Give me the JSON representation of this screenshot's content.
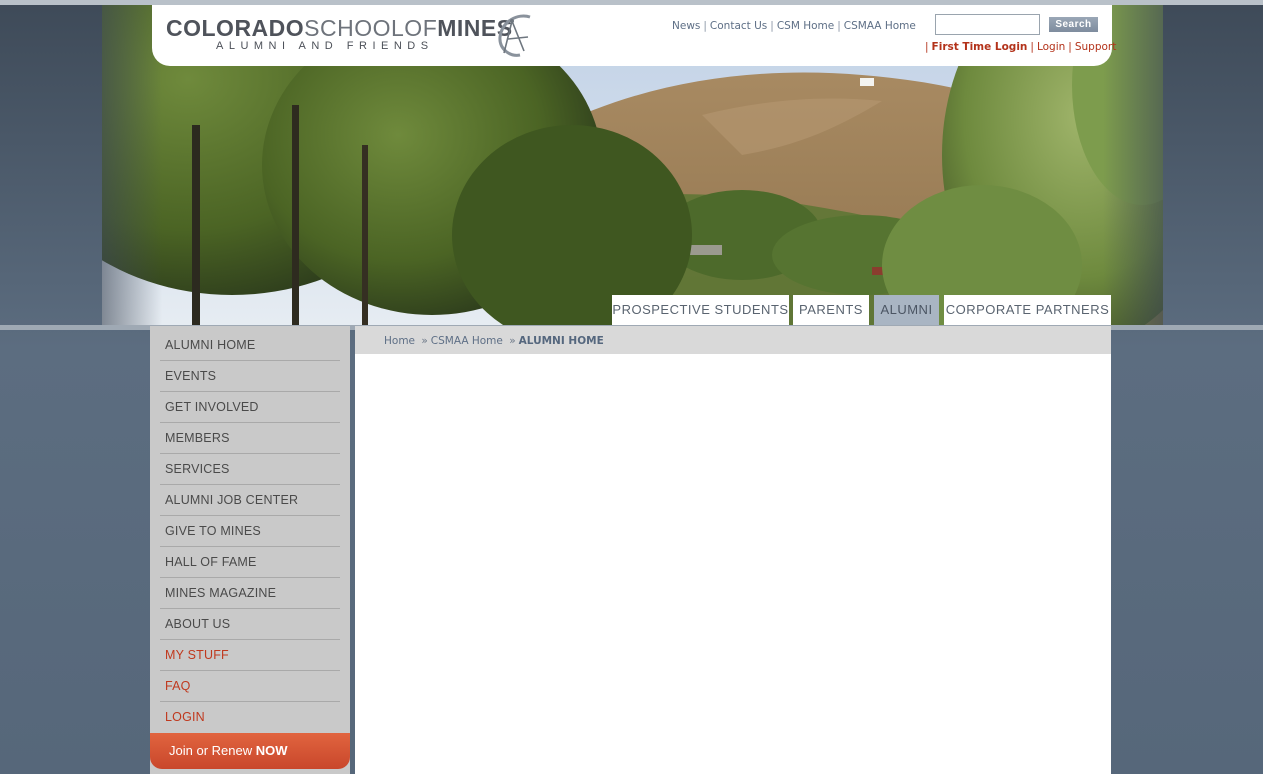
{
  "header": {
    "logo_colorado": "COLORADO",
    "logo_school": "SCHOOLOF",
    "logo_mines": "MINES",
    "logo_subtitle": "ALUMNI AND FRIENDS"
  },
  "utility_nav": {
    "items": [
      "News",
      "Contact Us",
      "CSM Home",
      "CSMAA Home"
    ]
  },
  "search": {
    "input_value": "",
    "button_label": "Search"
  },
  "login_nav": {
    "items": [
      "First Time Login",
      "Login",
      "Support"
    ]
  },
  "audience_tabs": {
    "items": [
      "PROSPECTIVE STUDENTS",
      "PARENTS",
      "ALUMNI",
      "CORPORATE PARTNERS"
    ],
    "active": "ALUMNI"
  },
  "sidebar": {
    "items": [
      "ALUMNI HOME",
      "EVENTS",
      "GET INVOLVED",
      "MEMBERS",
      "SERVICES",
      "ALUMNI JOB CENTER",
      "GIVE TO MINES",
      "HALL OF FAME",
      "MINES MAGAZINE",
      "ABOUT US",
      "MY STUFF",
      "FAQ",
      "LOGIN"
    ],
    "join_label": "Join or Renew",
    "join_emphasis": "NOW"
  },
  "breadcrumb": {
    "items": [
      "Home",
      "CSMAA Home"
    ],
    "current": "ALUMNI HOME",
    "separator": "»"
  },
  "colors": {
    "accent_red": "#c0391e",
    "link_blue": "#5e6f86",
    "active_tab": "#a9b5c3"
  }
}
